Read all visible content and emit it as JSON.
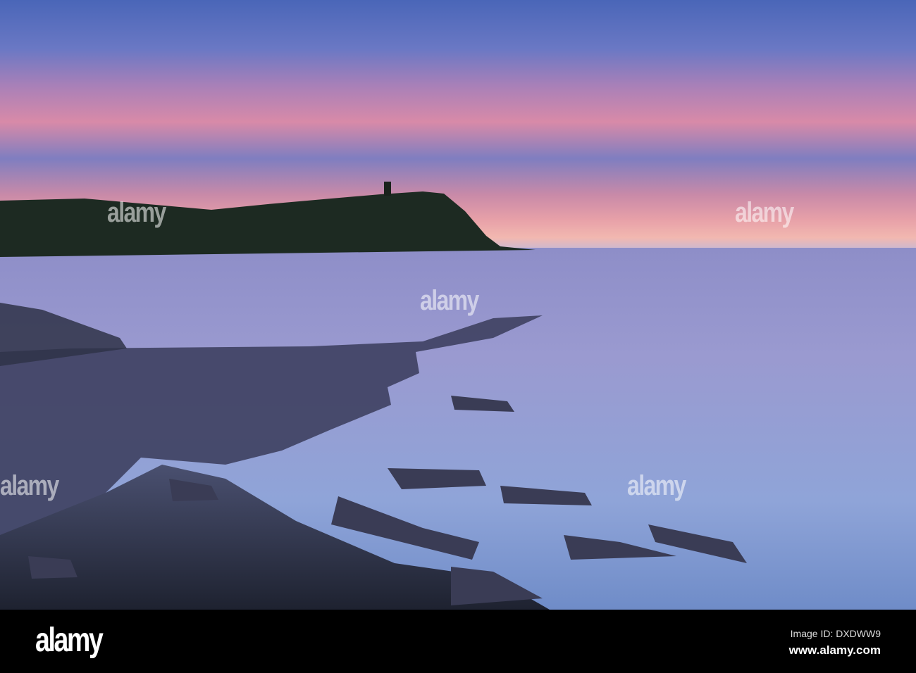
{
  "watermark": "alamy",
  "footer": {
    "logo": "alamy",
    "image_id": "Image ID: DXDWW9",
    "website": "www.alamy.com"
  },
  "colors": {
    "sky_pink": "#e7a0a8",
    "sky_blue": "#5d72c0",
    "sea": "#8d9ad0",
    "headland": "#1d2a22",
    "footer_bg": "#000000"
  }
}
